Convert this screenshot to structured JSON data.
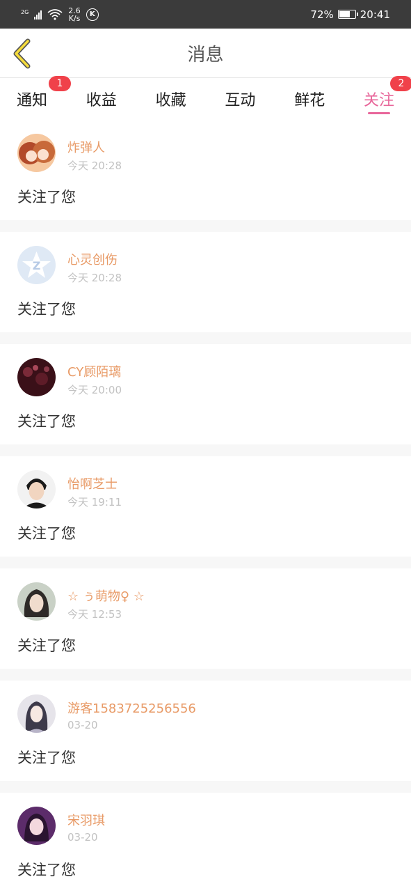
{
  "status_bar": {
    "network": "2G",
    "speed_value": "2.6",
    "speed_unit": "K/s",
    "app_icon": "k-circle-icon",
    "battery": "72%",
    "battery_level": 0.72,
    "time": "20:41"
  },
  "header": {
    "back_icon": "chevron-left-icon",
    "title": "消息"
  },
  "tabs": [
    {
      "label": "通知",
      "badge": "1"
    },
    {
      "label": "收益"
    },
    {
      "label": "收藏"
    },
    {
      "label": "互动"
    },
    {
      "label": "鲜花"
    },
    {
      "label": "关注",
      "badge": "2",
      "active": true
    }
  ],
  "colors": {
    "accent": "#e8669a",
    "name": "#e89a66",
    "badge": "#f0414a"
  },
  "items": [
    {
      "name": "炸弹人",
      "time": "今天 20:28",
      "message": "关注了您"
    },
    {
      "name": "心灵创伤",
      "time": "今天 20:28",
      "message": "关注了您"
    },
    {
      "name": "CY顾陌璃",
      "time": "今天 20:00",
      "message": "关注了您"
    },
    {
      "name": "怡啊芝士",
      "time": "今天 19:11",
      "message": "关注了您"
    },
    {
      "name": "☆ ぅ萌物♀ ☆",
      "time": "今天 12:53",
      "message": "关注了您"
    },
    {
      "name": "游客1583725256556",
      "time": "03-20",
      "message": "关注了您"
    },
    {
      "name": "宋羽琪",
      "time": "03-20",
      "message": "关注了您"
    }
  ]
}
